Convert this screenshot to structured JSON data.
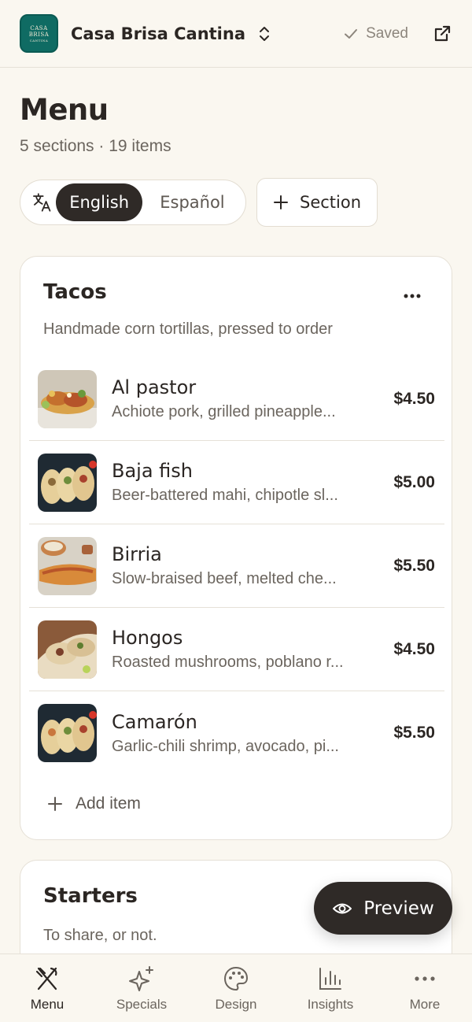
{
  "header": {
    "logo_text": "CASA BRISA CANTINA",
    "venue_name": "Casa Brisa Cantina",
    "saved_label": "Saved"
  },
  "page": {
    "title": "Menu",
    "subtitle": "5 sections · 19 items"
  },
  "language": {
    "options": [
      "English",
      "Español"
    ],
    "selected": "English"
  },
  "add_section_label": "Section",
  "sections": [
    {
      "title": "Tacos",
      "description": "Handmade corn tortillas, pressed to order",
      "items": [
        {
          "name": "Al pastor",
          "description": "Achiote pork, grilled pineapple...",
          "price": "$4.50"
        },
        {
          "name": "Baja fish",
          "description": "Beer-battered mahi, chipotle sl...",
          "price": "$5.00"
        },
        {
          "name": "Birria",
          "description": "Slow-braised beef, melted che...",
          "price": "$5.50"
        },
        {
          "name": "Hongos",
          "description": "Roasted mushrooms, poblano r...",
          "price": "$4.50"
        },
        {
          "name": "Camarón",
          "description": "Garlic-chili shrimp, avocado, pi...",
          "price": "$5.50"
        }
      ],
      "add_item_label": "Add item"
    },
    {
      "title": "Starters",
      "description": "To share, or not."
    }
  ],
  "preview_label": "Preview",
  "bottom_nav": [
    {
      "label": "Menu",
      "icon": "fork-knife-icon",
      "active": true
    },
    {
      "label": "Specials",
      "icon": "sparkle-icon",
      "active": false
    },
    {
      "label": "Design",
      "icon": "palette-icon",
      "active": false
    },
    {
      "label": "Insights",
      "icon": "bar-chart-icon",
      "active": false
    },
    {
      "label": "More",
      "icon": "more-icon",
      "active": false
    }
  ],
  "colors": {
    "background": "#faf7f0",
    "dark": "#2f2a27",
    "logo_teal": "#0f6b63"
  }
}
